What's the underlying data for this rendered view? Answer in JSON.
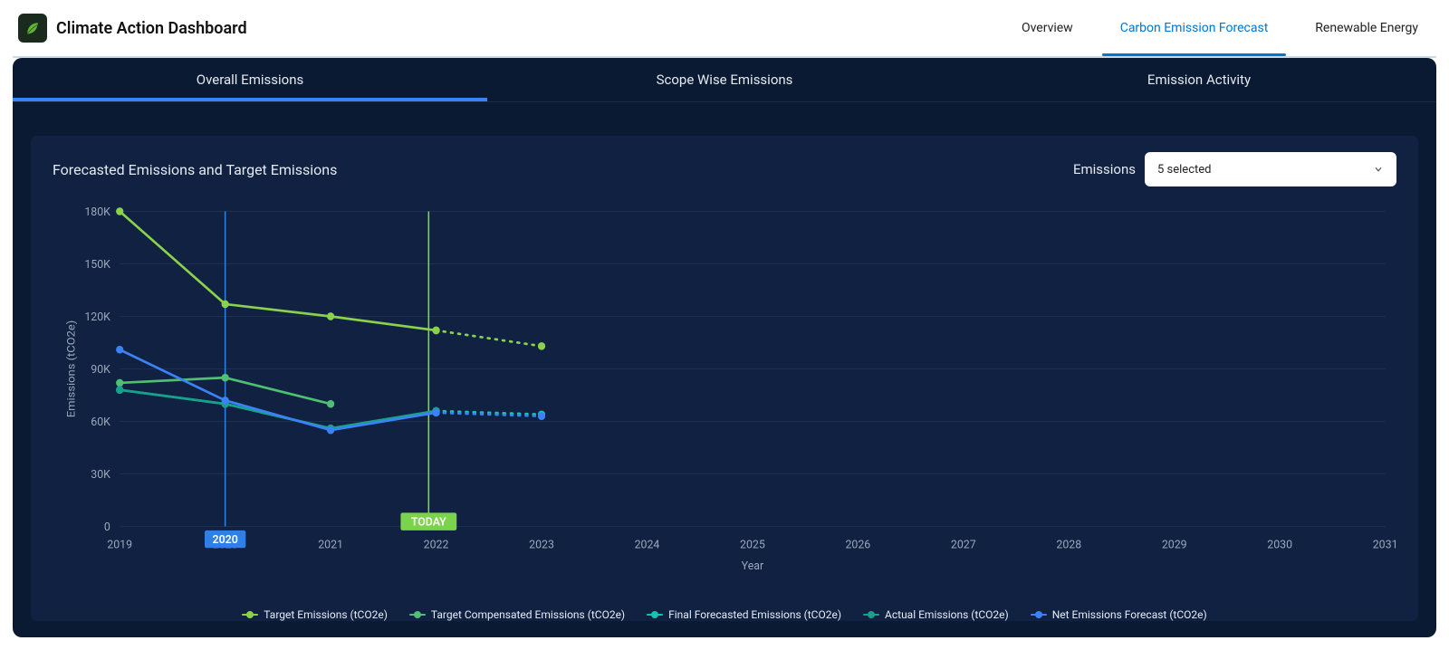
{
  "app": {
    "title": "Climate Action Dashboard"
  },
  "topnav": {
    "items": [
      "Overview",
      "Carbon Emission Forecast",
      "Renewable Energy"
    ],
    "active_index": 1
  },
  "subtabs": {
    "items": [
      "Overall Emissions",
      "Scope Wise Emissions",
      "Emission Activity"
    ],
    "active_index": 0
  },
  "chart": {
    "title": "Forecasted Emissions and Target Emissions",
    "selector_label": "Emissions",
    "selector_value": "5 selected",
    "markers": {
      "today_label": "TODAY",
      "scrub_year_label": "2020"
    }
  },
  "colors": {
    "target": "#8ad24a",
    "target_comp": "#4fbf73",
    "final_forecast": "#16c3b0",
    "actual": "#19a08d",
    "net_forecast": "#3b82f6",
    "grid": "rgba(255,255,255,0.06)"
  },
  "chart_data": {
    "type": "line",
    "title": "Forecasted Emissions and Target Emissions",
    "xlabel": "Year",
    "ylabel": "Emissions (tCO2e)",
    "x": [
      2019,
      2020,
      2021,
      2022,
      2023,
      2024,
      2025,
      2026,
      2027,
      2028,
      2029,
      2030,
      2031
    ],
    "ylim": [
      0,
      180000
    ],
    "y_ticks": [
      0,
      30000,
      60000,
      90000,
      120000,
      150000,
      180000
    ],
    "y_tick_labels": [
      "0",
      "30K",
      "60K",
      "90K",
      "120K",
      "150K",
      "180K"
    ],
    "today_x": 2022,
    "scrub_x": 2020,
    "series": [
      {
        "name": "Target Emissions (tCO2e)",
        "color": "#8ad24a",
        "segments": [
          {
            "style": "solid",
            "points": [
              [
                2019,
                180000
              ],
              [
                2020,
                127000
              ],
              [
                2021,
                120000
              ],
              [
                2022,
                112000
              ]
            ]
          },
          {
            "style": "dotted",
            "points": [
              [
                2022,
                112000
              ],
              [
                2023,
                103000
              ]
            ]
          }
        ]
      },
      {
        "name": "Target Compensated Emissions (tCO2e)",
        "color": "#4fbf73",
        "segments": [
          {
            "style": "solid",
            "points": [
              [
                2019,
                82000
              ],
              [
                2020,
                85000
              ],
              [
                2021,
                70000
              ]
            ]
          }
        ]
      },
      {
        "name": "Final Forecasted Emissions (tCO2e)",
        "color": "#16c3b0",
        "segments": [
          {
            "style": "solid",
            "points": [
              [
                2019,
                78000
              ],
              [
                2020,
                70000
              ],
              [
                2021,
                56000
              ],
              [
                2022,
                66000
              ]
            ]
          },
          {
            "style": "dotted",
            "points": [
              [
                2022,
                66000
              ],
              [
                2023,
                64000
              ]
            ]
          }
        ]
      },
      {
        "name": "Actual Emissions (tCO2e)",
        "color": "#19a08d",
        "segments": [
          {
            "style": "solid",
            "points": [
              [
                2019,
                78000
              ],
              [
                2020,
                70000
              ],
              [
                2021,
                56000
              ],
              [
                2022,
                66000
              ]
            ]
          }
        ]
      },
      {
        "name": "Net Emissions Forecast (tCO2e)",
        "color": "#3b82f6",
        "segments": [
          {
            "style": "solid",
            "points": [
              [
                2019,
                101000
              ],
              [
                2020,
                72000
              ],
              [
                2021,
                55000
              ],
              [
                2022,
                65000
              ]
            ]
          },
          {
            "style": "dotted",
            "points": [
              [
                2022,
                65000
              ],
              [
                2023,
                63000
              ]
            ]
          }
        ]
      }
    ],
    "legend": [
      "Target Emissions (tCO2e)",
      "Target Compensated Emissions (tCO2e)",
      "Final Forecasted Emissions (tCO2e)",
      "Actual Emissions (tCO2e)",
      "Net Emissions Forecast (tCO2e)"
    ]
  }
}
